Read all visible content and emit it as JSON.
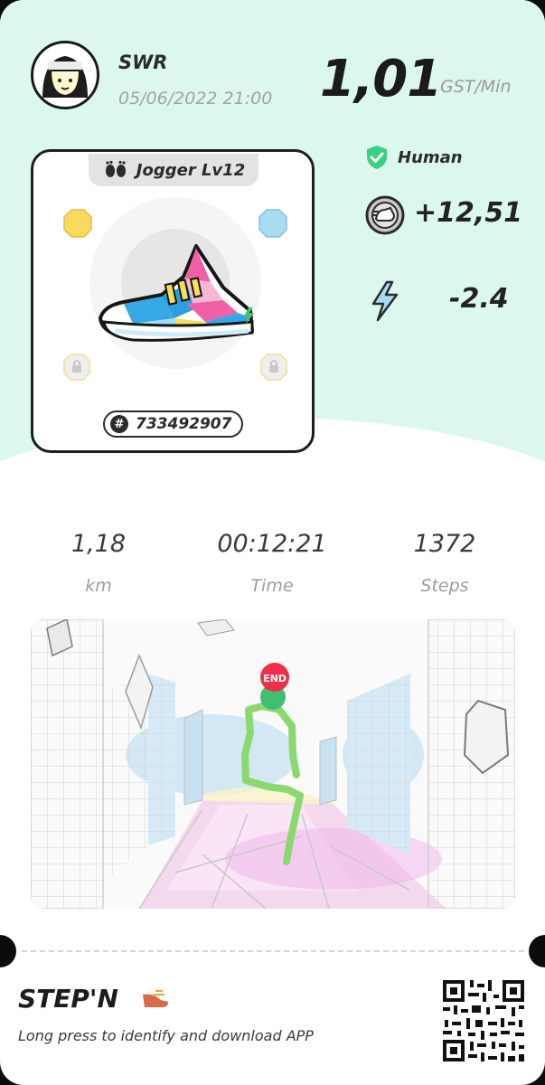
{
  "user": {
    "name": "SWR",
    "datetime": "05/06/2022 21:00"
  },
  "earning_rate": {
    "value": "1,01",
    "unit": "GST/Min"
  },
  "sneaker": {
    "type_label": "Jogger Lv12",
    "id": "733492907",
    "gem_colors": [
      "#f7d95e",
      "#a8dcf0"
    ]
  },
  "mode": {
    "label": "Human",
    "badge_color": "#3bd07d"
  },
  "earned": {
    "value": "+12,51",
    "icon": "gst-coin-icon"
  },
  "energy": {
    "value": "-2.4",
    "icon": "lightning-icon",
    "color": "#a8dcf6"
  },
  "stats": [
    {
      "value": "1,18",
      "label": "km"
    },
    {
      "value": "00:12:21",
      "label": "Time"
    },
    {
      "value": "1372",
      "label": "Steps"
    }
  ],
  "map": {
    "end_marker": "END",
    "route_color": "#8ad86e"
  },
  "footer": {
    "brand": "STEP'N",
    "download_text": "Long press to identify and download APP"
  }
}
